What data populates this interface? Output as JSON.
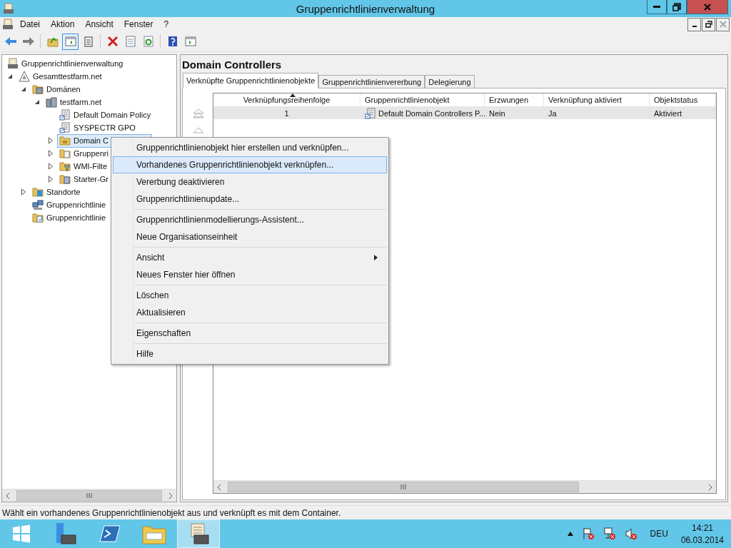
{
  "window": {
    "title": "Gruppenrichtlinienverwaltung"
  },
  "menu_bar": [
    "Datei",
    "Aktion",
    "Ansicht",
    "Fenster",
    "?"
  ],
  "toolbar": [
    {
      "kind": "back",
      "pressed": false
    },
    {
      "kind": "forward",
      "pressed": false
    },
    {
      "kind": "separator"
    },
    {
      "kind": "up",
      "pressed": false
    },
    {
      "kind": "tree-pane",
      "pressed": true
    },
    {
      "kind": "clipboard",
      "pressed": false
    },
    {
      "kind": "separator"
    },
    {
      "kind": "delete",
      "pressed": false
    },
    {
      "kind": "properties",
      "pressed": false
    },
    {
      "kind": "refresh",
      "pressed": false
    },
    {
      "kind": "separator"
    },
    {
      "kind": "help",
      "pressed": false
    },
    {
      "kind": "action-pane",
      "pressed": false
    }
  ],
  "tree": [
    {
      "label": "Gruppenrichtlinienverwaltung",
      "kind": "console",
      "selected": false,
      "children": [
        {
          "label": "Gesamttestfarm.net",
          "kind": "forest",
          "expanded": true,
          "selected": false,
          "children": [
            {
              "label": "Domänen",
              "kind": "domains",
              "expanded": true,
              "selected": false,
              "children": [
                {
                  "label": "testfarm.net",
                  "kind": "domain",
                  "expanded": true,
                  "selected": false,
                  "children": [
                    {
                      "label": "Default Domain Policy",
                      "kind": "gpo-link",
                      "selected": false
                    },
                    {
                      "label": "SYSPECTR GPO",
                      "kind": "gpo-link",
                      "selected": false
                    },
                    {
                      "label": "Domain C",
                      "kind": "ou",
                      "expanded": false,
                      "selected": true
                    },
                    {
                      "label": "Gruppenri",
                      "kind": "gpo-folder",
                      "expanded": false,
                      "selected": false
                    },
                    {
                      "label": "WMI-Filte",
                      "kind": "wmi",
                      "expanded": false,
                      "selected": false
                    },
                    {
                      "label": "Starter-Gr",
                      "kind": "starter",
                      "expanded": false,
                      "selected": false
                    }
                  ]
                }
              ]
            },
            {
              "label": "Standorte",
              "kind": "sites",
              "expanded": false,
              "selected": false
            },
            {
              "label": "Gruppenrichtlinie",
              "kind": "modeling",
              "selected": false
            },
            {
              "label": "Gruppenrichtlinie",
              "kind": "results",
              "selected": false
            }
          ]
        }
      ]
    }
  ],
  "details": {
    "title": "Domain Controllers",
    "tabs": [
      {
        "label": "Verknüpfte Gruppenrichtlinienobjekte",
        "selected": true
      },
      {
        "label": "Gruppenrichtlinienvererbung",
        "selected": false
      },
      {
        "label": "Delegierung",
        "selected": false
      }
    ],
    "table": {
      "columns": [
        {
          "label": "Verknüpfungsreihenfolge",
          "sorted": true
        },
        {
          "label": "Gruppenrichtlinienobjekt",
          "sorted": false
        },
        {
          "label": "Erzwungen",
          "sorted": false
        },
        {
          "label": "Verknüpfung aktiviert",
          "sorted": false
        },
        {
          "label": "Objektstatus",
          "sorted": false
        }
      ],
      "rows": [
        {
          "selected": true,
          "cells": [
            "1",
            "Default Domain Controllers P...",
            "Nein",
            "Ja",
            "Aktiviert"
          ]
        }
      ]
    }
  },
  "context_menu": [
    [
      {
        "label": "Gruppenrichtlinienobjekt hier erstellen und verknüpfen...",
        "selected": false,
        "submenu": false
      },
      {
        "label": "Vorhandenes Gruppenrichtlinienobjekt verknüpfen...",
        "selected": true,
        "submenu": false
      },
      {
        "label": "Vererbung deaktivieren",
        "selected": false,
        "submenu": false
      },
      {
        "label": "Gruppenrichtlinienupdate...",
        "selected": false,
        "submenu": false
      }
    ],
    [
      {
        "label": "Gruppenrichtlinienmodellierungs-Assistent...",
        "selected": false,
        "submenu": false
      },
      {
        "label": "Neue Organisationseinheit",
        "selected": false,
        "submenu": false
      }
    ],
    [
      {
        "label": "Ansicht",
        "selected": false,
        "submenu": true
      },
      {
        "label": "Neues Fenster hier öffnen",
        "selected": false,
        "submenu": false
      }
    ],
    [
      {
        "label": "Löschen",
        "selected": false,
        "submenu": false
      },
      {
        "label": "Aktualisieren",
        "selected": false,
        "submenu": false
      }
    ],
    [
      {
        "label": "Eigenschaften",
        "selected": false,
        "submenu": false
      }
    ],
    [
      {
        "label": "Hilfe",
        "selected": false,
        "submenu": false
      }
    ]
  ],
  "status_bar": "Wählt ein vorhandenes Gruppenrichtlinienobjekt aus und verknüpft es mit dem Container.",
  "taskbar": {
    "apps": [
      {
        "kind": "start",
        "selected": false
      },
      {
        "kind": "server-manager",
        "selected": false
      },
      {
        "kind": "powershell",
        "selected": false
      },
      {
        "kind": "explorer",
        "selected": false
      },
      {
        "kind": "gpmc",
        "selected": true
      }
    ],
    "language": "DEU",
    "time": "14:21",
    "date": "06.03.2014"
  }
}
